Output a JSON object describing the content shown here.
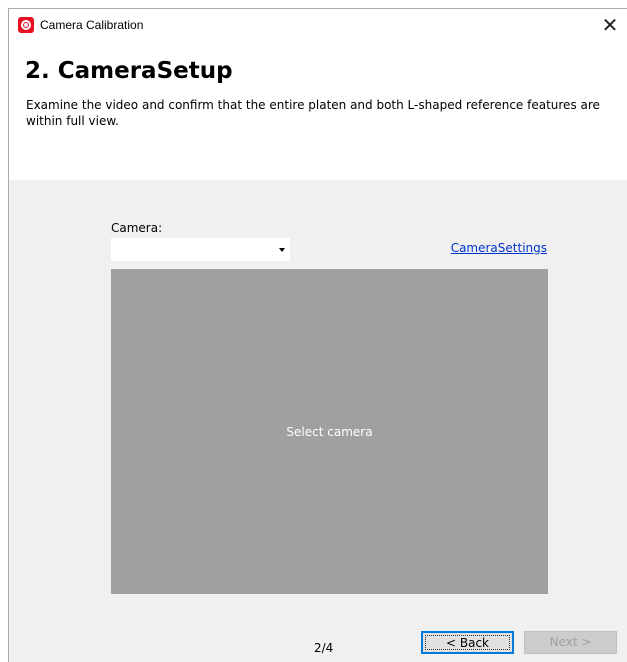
{
  "window": {
    "title": "Camera Calibration",
    "close_glyph": "✕",
    "app_icon": "camera-calibration-app-icon"
  },
  "step": {
    "heading": "2. CameraSetup",
    "description": "Examine the video and confirm that the entire platen and both L-shaped reference features are within full view."
  },
  "camera": {
    "label": "Camera:",
    "selected_value": "",
    "settings_link": "CameraSettings"
  },
  "video": {
    "placeholder": "Select camera"
  },
  "footer": {
    "page_indicator": "2/4",
    "back_label": "< Back",
    "next_label": "Next >"
  },
  "colors": {
    "accent": "#0078d7",
    "link": "#0033cc",
    "app_icon": "#e81123",
    "panel_bg": "#f0f0f0",
    "video_bg": "#a0a0a0"
  }
}
